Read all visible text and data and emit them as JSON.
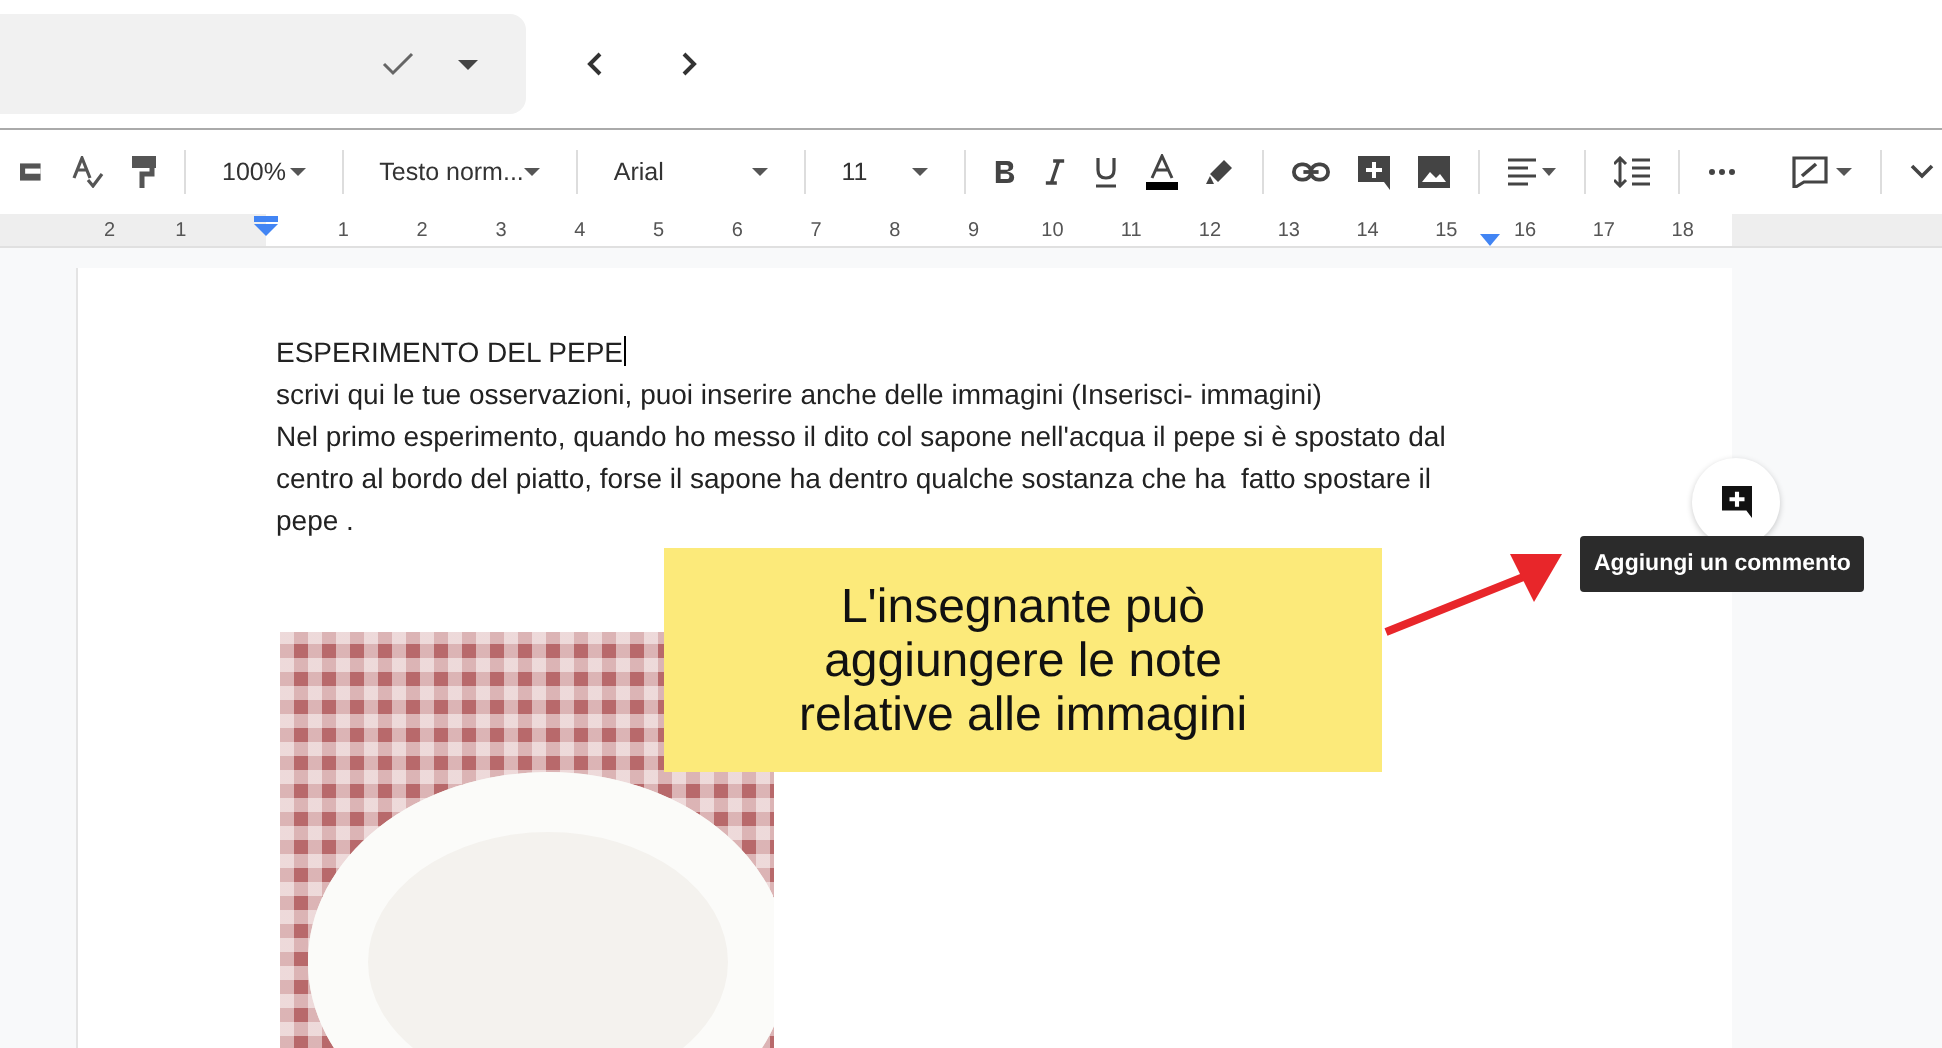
{
  "toolbar": {
    "zoom": "100%",
    "style": "Testo norm...",
    "font": "Arial",
    "font_size": "11"
  },
  "ruler": {
    "left_labels": [
      "2",
      "1"
    ],
    "labels": [
      "1",
      "2",
      "3",
      "4",
      "5",
      "6",
      "7",
      "8",
      "9",
      "10",
      "11",
      "12",
      "13",
      "14",
      "15",
      "16",
      "17",
      "18"
    ]
  },
  "document": {
    "title": "ESPERIMENTO DEL PEPE",
    "paragraphs": [
      "scrivi qui le tue osservazioni, puoi inserire anche delle immagini (Inserisci- immagini)",
      "Nel primo esperimento, quando ho messo il dito col sapone nell'acqua il pepe si è spostato dal centro al bordo del piatto, forse il sapone ha dentro qualche sostanza che ha  fatto spostare il pepe ."
    ]
  },
  "callout": {
    "text": "L'insegnante può aggiungere le note relative alle immagini"
  },
  "tooltip": {
    "text": "Aggiungi un commento"
  }
}
